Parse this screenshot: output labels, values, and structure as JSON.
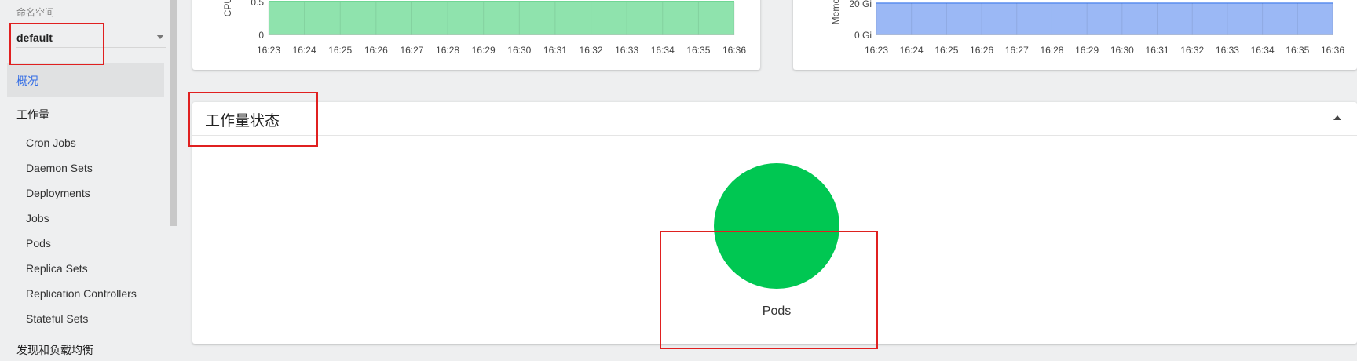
{
  "sidebar": {
    "namespace_label": "命名空间",
    "namespace_value": "default",
    "overview_label": "概况",
    "workloads_label": "工作量",
    "workload_items": [
      "Cron Jobs",
      "Daemon Sets",
      "Deployments",
      "Jobs",
      "Pods",
      "Replica Sets",
      "Replication Controllers",
      "Stateful Sets"
    ],
    "discovery_label": "发现和负载均衡"
  },
  "cpu_chart": {
    "ylabel": "CPU",
    "yticks": [
      "0.5",
      "0"
    ],
    "xticks": [
      "16:23",
      "16:24",
      "16:25",
      "16:26",
      "16:27",
      "16:28",
      "16:29",
      "16:30",
      "16:31",
      "16:32",
      "16:33",
      "16:34",
      "16:35",
      "16:36"
    ],
    "fill_color": "#8fe3ad",
    "line_color": "#41c870"
  },
  "memory_chart": {
    "ylabel": "Memo",
    "yticks": [
      "20 Gi",
      "0 Gi"
    ],
    "xticks": [
      "16:23",
      "16:24",
      "16:25",
      "16:26",
      "16:27",
      "16:28",
      "16:29",
      "16:30",
      "16:31",
      "16:32",
      "16:33",
      "16:34",
      "16:35",
      "16:36"
    ],
    "fill_color": "#9bb8f5",
    "line_color": "#5b8def"
  },
  "workload_status": {
    "title": "工作量状态",
    "pods_label": "Pods",
    "pods_color": "#00c752"
  },
  "colors": {
    "accent": "#326ce5",
    "highlight": "#e02020"
  },
  "icons": {
    "namespace_dropdown": "caret-down-icon",
    "collapse": "caret-up-icon"
  }
}
